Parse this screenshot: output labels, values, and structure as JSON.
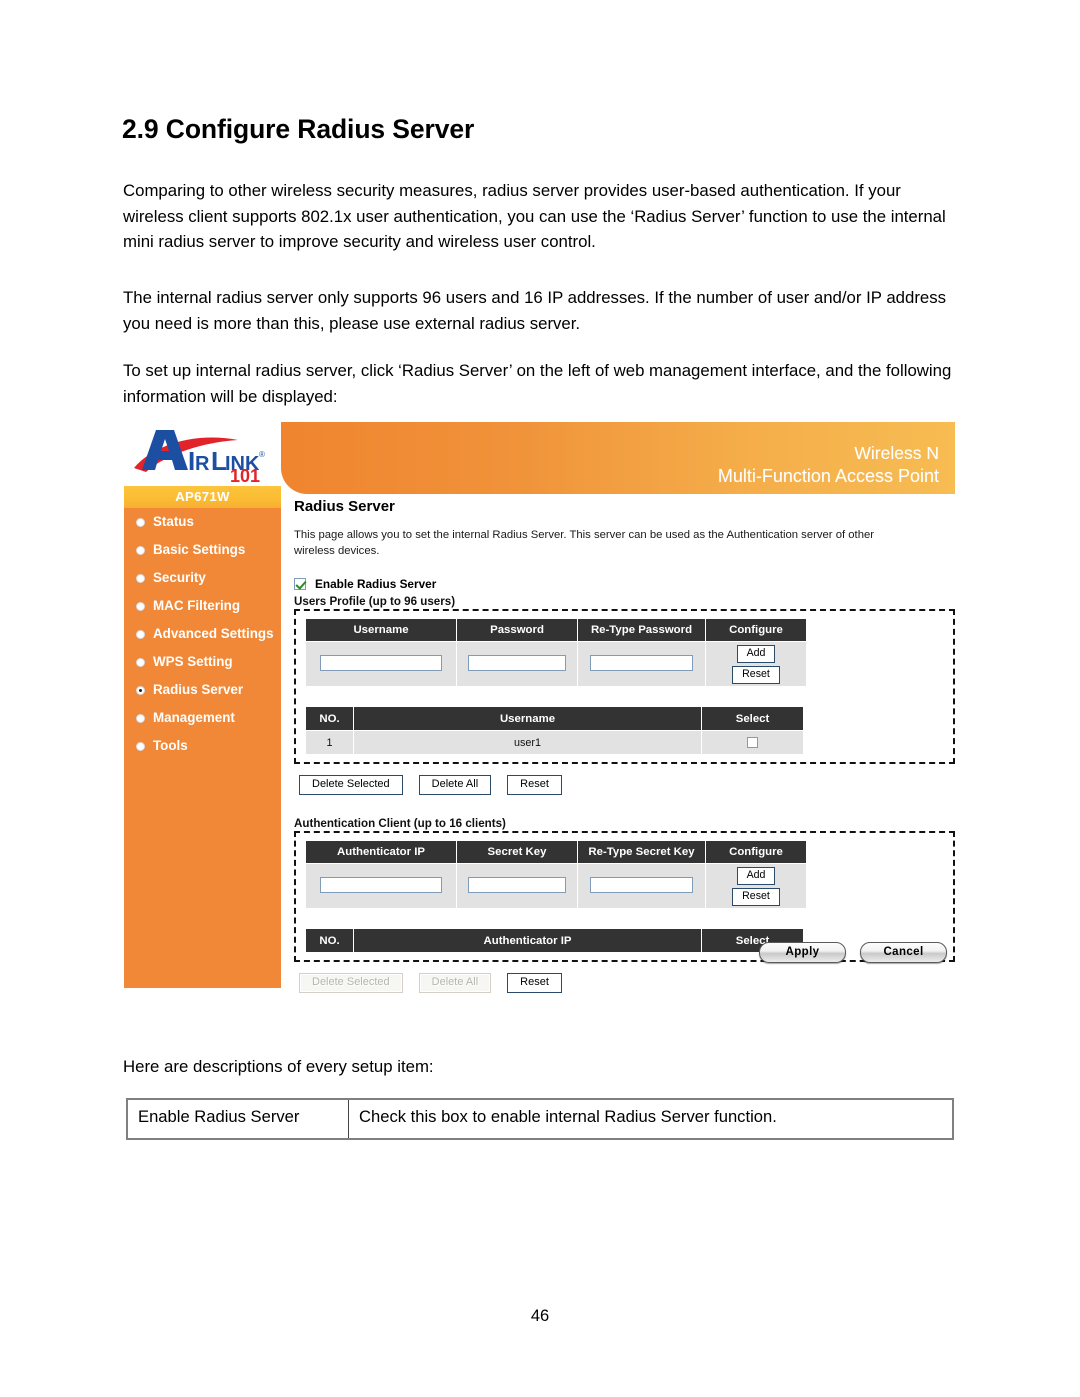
{
  "document": {
    "title": "2.9 Configure Radius Server",
    "paragraphs": [
      "Comparing to other wireless security measures, radius server provides user-based authentication. If your wireless client supports 802.1x user authentication, you can use the ‘Radius Server’ function to use the internal mini radius server to improve security and wireless user control.",
      "The internal radius server only supports 96 users and 16 IP addresses. If the number of user and/or IP address you need is more than this, please use external radius server.",
      "To set up internal radius server, click ‘Radius Server’ on the left of web management interface, and the following information will be displayed:",
      "Here are descriptions of every setup item:"
    ],
    "page_number": "46"
  },
  "description_table": {
    "rows": [
      {
        "item": "Enable Radius Server",
        "description": "Check this box to enable internal Radius Server function."
      }
    ]
  },
  "screenshot": {
    "logo": {
      "brand": "AIRLINK",
      "suffix": "101",
      "trademark": "®"
    },
    "banner": {
      "line1": "Wireless N",
      "line2": "Multi-Function Access Point"
    },
    "sidebar": {
      "model": "AP671W",
      "items": [
        {
          "label": "Status",
          "active": false
        },
        {
          "label": "Basic Settings",
          "active": false
        },
        {
          "label": "Security",
          "active": false
        },
        {
          "label": "MAC Filtering",
          "active": false
        },
        {
          "label": "Advanced Settings",
          "active": false
        },
        {
          "label": "WPS Setting",
          "active": false
        },
        {
          "label": "Radius Server",
          "active": true
        },
        {
          "label": "Management",
          "active": false
        },
        {
          "label": "Tools",
          "active": false
        }
      ]
    },
    "page": {
      "title": "Radius Server",
      "description": "This page allows you to set the internal Radius Server. This server can be used as the Authentication server of other wireless devices.",
      "enable_checkbox": {
        "label": "Enable Radius Server",
        "checked": true
      },
      "users_profile": {
        "label": "Users Profile (up to 96 users)",
        "form_headers": [
          "Username",
          "Password",
          "Re-Type Password",
          "Configure"
        ],
        "form_values": [
          "",
          "",
          ""
        ],
        "add_label": "Add",
        "reset_label": "Reset",
        "list_headers": [
          "NO.",
          "Username",
          "Select"
        ],
        "list_rows": [
          {
            "no": "1",
            "username": "user1",
            "selected": false
          }
        ],
        "buttons": [
          {
            "label": "Delete Selected",
            "disabled": false
          },
          {
            "label": "Delete All",
            "disabled": false
          },
          {
            "label": "Reset",
            "disabled": false
          }
        ]
      },
      "authentication_client": {
        "label": "Authentication Client (up to 16 clients)",
        "form_headers": [
          "Authenticator IP",
          "Secret Key",
          "Re-Type Secret Key",
          "Configure"
        ],
        "form_values": [
          "",
          "",
          ""
        ],
        "add_label": "Add",
        "reset_label": "Reset",
        "list_headers": [
          "NO.",
          "Authenticator IP",
          "Select"
        ],
        "list_rows": [],
        "buttons": [
          {
            "label": "Delete Selected",
            "disabled": true
          },
          {
            "label": "Delete All",
            "disabled": true
          },
          {
            "label": "Reset",
            "disabled": false
          }
        ]
      },
      "footer_buttons": {
        "apply": "Apply",
        "cancel": "Cancel"
      }
    },
    "colors": {
      "orange": "#f08837",
      "amber": "#fbbc33",
      "banner_start": "#f0842f",
      "banner_end": "#f7bc52",
      "header_dark": "#333333",
      "row_grey": "#e2e2e2",
      "logo_blue": "#1c4fa1",
      "logo_red": "#e2232a"
    }
  }
}
